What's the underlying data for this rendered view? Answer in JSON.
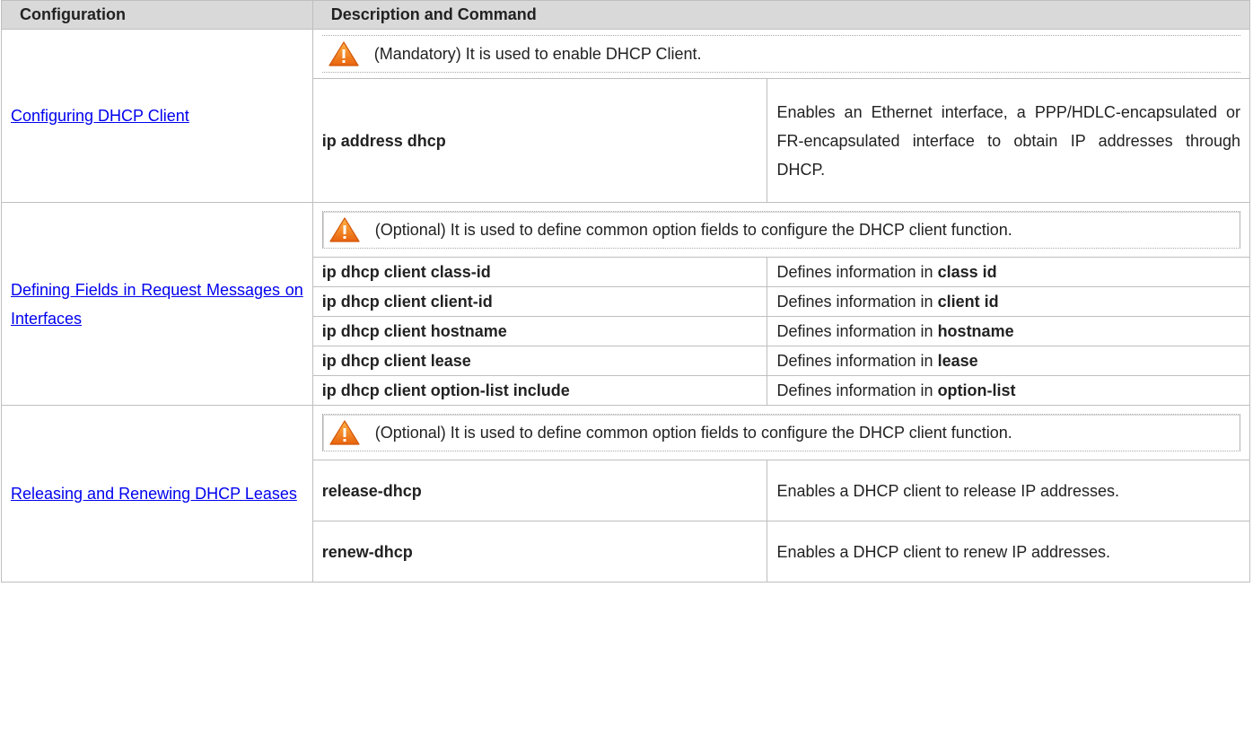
{
  "header": {
    "configuration": "Configuration",
    "description": "Description and Command"
  },
  "colors": {
    "header_bg": "#d9d9d9",
    "link": "#0000ee",
    "warning_icon": "#f07a1a"
  },
  "sections": [
    {
      "config_link": "Configuring DHCP Client",
      "note_icon": "warning-icon",
      "note": "(Mandatory) It is used to enable DHCP Client.",
      "commands": [
        {
          "command": "ip address dhcp",
          "description": "Enables an Ethernet interface, a PPP/HDLC-encapsulated or FR-encapsulated interface to obtain IP addresses through DHCP."
        }
      ]
    },
    {
      "config_link": "Defining Fields in Request Messages on Interfaces",
      "note_icon": "warning-icon",
      "note": "(Optional) It is used to define common option fields to configure the DHCP client function.",
      "commands": [
        {
          "command": "ip dhcp client class-id",
          "description_prefix": "Defines information in ",
          "description_bold": "class id"
        },
        {
          "command": "ip dhcp client client-id",
          "description_prefix": "Defines information in ",
          "description_bold": "client id"
        },
        {
          "command": "ip dhcp client hostname",
          "description_prefix": "Defines information in ",
          "description_bold": "hostname"
        },
        {
          "command": "ip dhcp client lease",
          "description_prefix": "Defines information in ",
          "description_bold": "lease"
        },
        {
          "command": "ip dhcp client option-list include",
          "description_prefix": "Defines information in ",
          "description_bold": "option-list"
        }
      ]
    },
    {
      "config_link": "Releasing and Renewing DHCP Leases",
      "note_icon": "warning-icon",
      "note": "(Optional) It is used to define common option fields to configure the DHCP client function.",
      "commands": [
        {
          "command": "release-dhcp",
          "description": "Enables a DHCP client to release IP addresses."
        },
        {
          "command": "renew-dhcp",
          "description": "Enables a DHCP client to renew IP addresses."
        }
      ]
    }
  ]
}
